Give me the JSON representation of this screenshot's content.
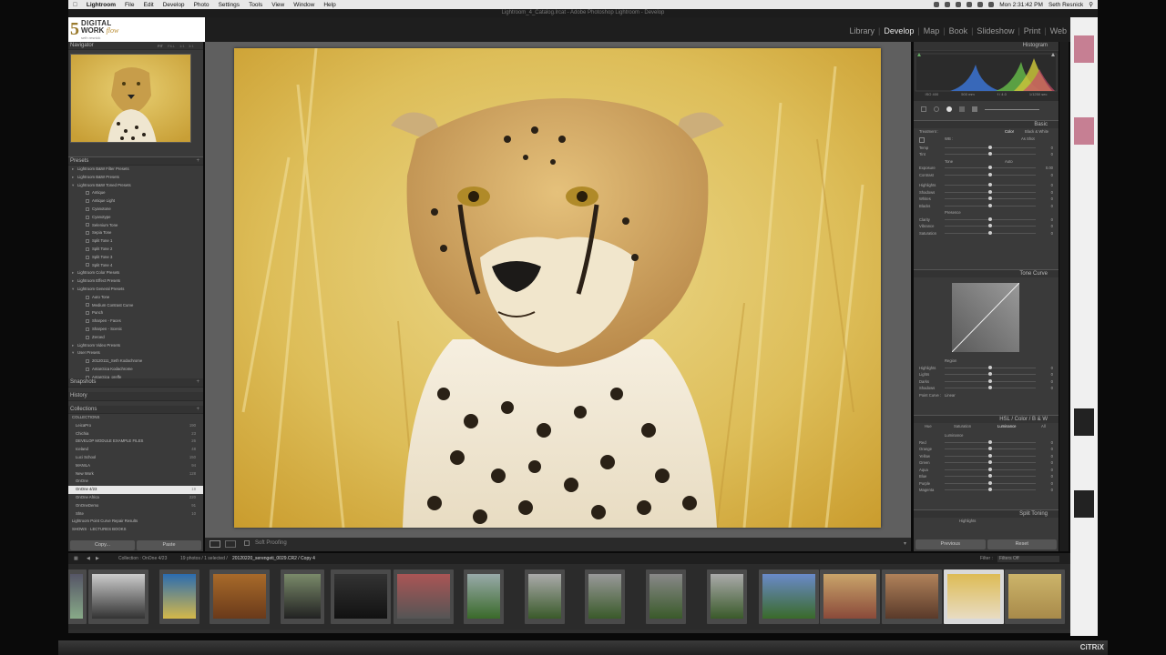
{
  "menubar": {
    "app": "Lightroom",
    "items": [
      "File",
      "Edit",
      "Develop",
      "Photo",
      "Settings",
      "Tools",
      "View",
      "Window",
      "Help"
    ],
    "clock": "Mon 2:31:42 PM",
    "user": "Seth Resnick"
  },
  "window_title": "Lightroom_4_Catalog.lrcat - Adobe Photoshop Lightroom - Develop",
  "identity_plate": {
    "number": "5",
    "line1": "DIGITAL",
    "line2": "WORK",
    "line2_italic": "flow",
    "line3": "seth resnick"
  },
  "modules": [
    "Library",
    "Develop",
    "Map",
    "Book",
    "Slideshow",
    "Print",
    "Web"
  ],
  "active_module": "Develop",
  "left_panel": {
    "navigator": {
      "title": "Navigator",
      "options": [
        "FIT",
        "FILL",
        "1:1",
        "3:1"
      ]
    },
    "presets_title": "Presets",
    "presets": [
      {
        "label": "Lightroom B&W Filter Presets",
        "level": 0
      },
      {
        "label": "Lightroom B&W Presets",
        "level": 0
      },
      {
        "label": "Lightroom B&W Toned Presets",
        "level": 0,
        "open": true
      },
      {
        "label": "Antique",
        "level": 1
      },
      {
        "label": "Antique Light",
        "level": 1
      },
      {
        "label": "Cyanotone",
        "level": 1
      },
      {
        "label": "Cyanotype",
        "level": 1
      },
      {
        "label": "Selenium Tone",
        "level": 1
      },
      {
        "label": "Sepia Tone",
        "level": 1
      },
      {
        "label": "Split Tone 1",
        "level": 1
      },
      {
        "label": "Split Tone 2",
        "level": 1
      },
      {
        "label": "Split Tone 3",
        "level": 1
      },
      {
        "label": "Split Tone 4",
        "level": 1
      },
      {
        "label": "Lightroom Color Presets",
        "level": 0
      },
      {
        "label": "Lightroom Effect Presets",
        "level": 0
      },
      {
        "label": "Lightroom General Presets",
        "level": 0,
        "open": true
      },
      {
        "label": "Auto Tone",
        "level": 1
      },
      {
        "label": "Medium Contrast Curve",
        "level": 1
      },
      {
        "label": "Punch",
        "level": 1
      },
      {
        "label": "Sharpen - Faces",
        "level": 1
      },
      {
        "label": "Sharpen - Scenic",
        "level": 1
      },
      {
        "label": "Zeroed",
        "level": 1
      },
      {
        "label": "Lightroom Video Presets",
        "level": 0
      },
      {
        "label": "User Presets",
        "level": 0,
        "open": true
      },
      {
        "label": "20120111_Seth Kodachrome",
        "level": 1
      },
      {
        "label": "Antarctica Kodachrome",
        "level": 1
      },
      {
        "label": "Antarctica_preffe",
        "level": 1
      }
    ],
    "snapshots_title": "Snapshots",
    "history_title": "History",
    "collections_title": "Collections",
    "collections_group": "COLLECTIONS",
    "collections": [
      {
        "label": "LeicaPro",
        "count": "190"
      },
      {
        "label": "Chichia",
        "count": "23"
      },
      {
        "label": "DEVELOP MODULE EXAMPLE FILES",
        "count": "26"
      },
      {
        "label": "Iceland",
        "count": "48"
      },
      {
        "label": "Luci School",
        "count": "150"
      },
      {
        "label": "MANILA",
        "count": "94"
      },
      {
        "label": "New Work",
        "count": "128"
      },
      {
        "label": "OnOne",
        "count": ""
      },
      {
        "label": "OnOne 4/23",
        "count": "19",
        "selected": true
      },
      {
        "label": "OnOne Africa",
        "count": "220"
      },
      {
        "label": "OnOneDemo",
        "count": "91"
      },
      {
        "label": "Shte",
        "count": "10"
      }
    ],
    "extra_collections": [
      "Lightroom Point Curve Repair Results",
      "SHOWS · LECTURES BOOKS"
    ],
    "copy_button": "Copy...",
    "paste_button": "Paste"
  },
  "toolbar": {
    "soft_proofing": "Soft Proofing"
  },
  "right_panel": {
    "histogram_title": "Histogram",
    "histogram_meta": [
      "ISO 400",
      "500 mm",
      "f / 4.0",
      "1/1250 sec"
    ],
    "basic_title": "Basic",
    "treatment_label": "Treatment :",
    "treatment_color": "Color",
    "treatment_bw": "Black & White",
    "wb_label": "WB :",
    "wb_value": "As Shot",
    "wb_sliders": [
      {
        "label": "Temp",
        "pos": 0.5,
        "val": "0"
      },
      {
        "label": "Tint",
        "pos": 0.5,
        "val": "0"
      }
    ],
    "tone_label": "Tone",
    "auto_label": "Auto",
    "tone_sliders": [
      {
        "label": "Exposure",
        "pos": 0.5,
        "val": "0.00"
      },
      {
        "label": "Contrast",
        "pos": 0.5,
        "val": "0"
      }
    ],
    "tone2_sliders": [
      {
        "label": "Highlights",
        "pos": 0.5,
        "val": "0"
      },
      {
        "label": "Shadows",
        "pos": 0.5,
        "val": "0"
      },
      {
        "label": "Whites",
        "pos": 0.5,
        "val": "0"
      },
      {
        "label": "Blacks",
        "pos": 0.5,
        "val": "0"
      }
    ],
    "presence_label": "Presence",
    "presence_sliders": [
      {
        "label": "Clarity",
        "pos": 0.5,
        "val": "0"
      },
      {
        "label": "Vibrance",
        "pos": 0.5,
        "val": "0"
      },
      {
        "label": "Saturation",
        "pos": 0.5,
        "val": "0"
      }
    ],
    "tone_curve_title": "Tone Curve",
    "region_label": "Region",
    "curve_sliders": [
      {
        "label": "Highlights",
        "pos": 0.5,
        "val": "0"
      },
      {
        "label": "Lights",
        "pos": 0.5,
        "val": "0"
      },
      {
        "label": "Darks",
        "pos": 0.5,
        "val": "0"
      },
      {
        "label": "Shadows",
        "pos": 0.5,
        "val": "0"
      }
    ],
    "point_curve_label": "Point Curve :",
    "point_curve_value": "Linear",
    "hsl_title": "HSL / Color / B & W",
    "hsl_tabs": [
      "Hue",
      "Saturation",
      "Luminance",
      "All"
    ],
    "luminance_label": "Luminance",
    "hsl_sliders": [
      {
        "label": "Red",
        "pos": 0.5,
        "val": "0"
      },
      {
        "label": "Orange",
        "pos": 0.5,
        "val": "0"
      },
      {
        "label": "Yellow",
        "pos": 0.5,
        "val": "0"
      },
      {
        "label": "Green",
        "pos": 0.5,
        "val": "0"
      },
      {
        "label": "Aqua",
        "pos": 0.5,
        "val": "0"
      },
      {
        "label": "Blue",
        "pos": 0.5,
        "val": "0"
      },
      {
        "label": "Purple",
        "pos": 0.5,
        "val": "0"
      },
      {
        "label": "Magenta",
        "pos": 0.5,
        "val": "0"
      }
    ],
    "split_toning_title": "Split Toning",
    "split_highlights": "Highlights",
    "previous_button": "Previous",
    "reset_button": "Reset"
  },
  "filmstrip_bar": {
    "collection": "Collection : OnOne 4/23",
    "count": "19 photos / 1 selected /",
    "filename": "20120220_serengeti_0029.CR2 / Copy 4",
    "filter_label": "Filter :",
    "filter_value": "Filters Off"
  },
  "dock": {
    "brand": "CiTRiX"
  }
}
